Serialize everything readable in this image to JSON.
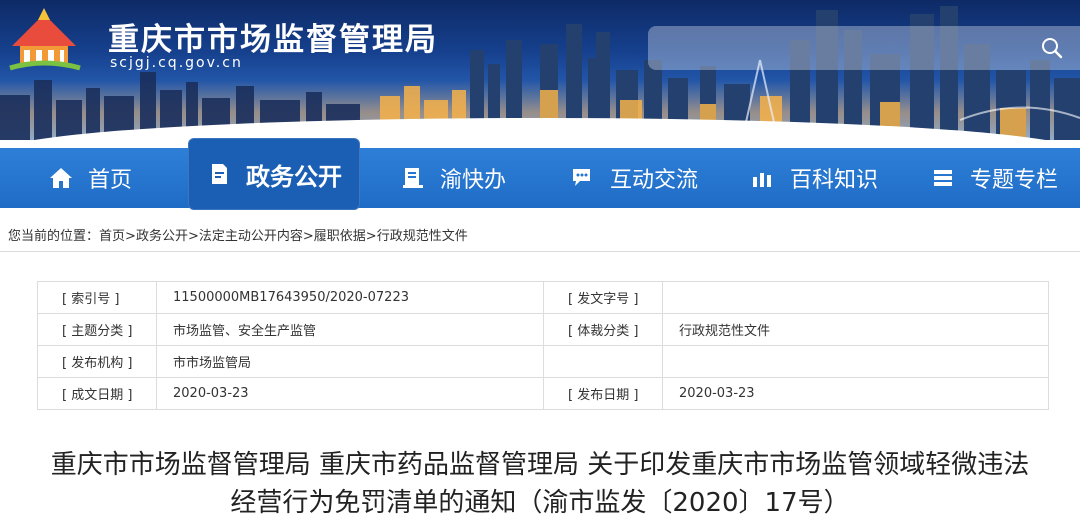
{
  "header": {
    "title": "重庆市市场监督管理局",
    "domain": "scjgj.cq.gov.cn",
    "search": {
      "placeholder": ""
    }
  },
  "nav": {
    "items": [
      {
        "label": "首页",
        "icon": "home-icon"
      },
      {
        "label": "政务公开",
        "icon": "document-icon",
        "active": true
      },
      {
        "label": "渝快办",
        "icon": "book-icon"
      },
      {
        "label": "互动交流",
        "icon": "chat-icon"
      },
      {
        "label": "百科知识",
        "icon": "chart-bars-icon"
      },
      {
        "label": "专题专栏",
        "icon": "stack-icon"
      }
    ]
  },
  "breadcrumb": {
    "prefix": "您当前的位置：",
    "items": [
      "首页",
      "政务公开",
      "法定主动公开内容",
      "履职依据",
      "行政规范性文件"
    ],
    "separator": ">"
  },
  "meta": {
    "index_label": "[ 索引号 ]",
    "index_value": "11500000MB17643950/2020-07223",
    "doc_no_label": "[ 发文字号 ]",
    "doc_no_value": "",
    "topic_label": "[ 主题分类 ]",
    "topic_value": "市场监管、安全生产监管",
    "genre_label": "[ 体裁分类 ]",
    "genre_value": "行政规范性文件",
    "issuer_label": "[ 发布机构 ]",
    "issuer_value": "市市场监管局",
    "created_label": "[ 成文日期 ]",
    "created_value": "2020-03-23",
    "published_label": "[ 发布日期 ]",
    "published_value": "2020-03-23"
  },
  "document": {
    "title_line1": "重庆市市场监督管理局 重庆市药品监督管理局 关于印发重庆市市场监管领域轻微违法",
    "title_line2": "经营行为免罚清单的通知（渝市监发〔2020〕17号）"
  },
  "colors": {
    "nav_bg": "#2476d0",
    "nav_active": "#1b5fb4",
    "banner_top": "#0e2a66",
    "text": "#333333"
  }
}
